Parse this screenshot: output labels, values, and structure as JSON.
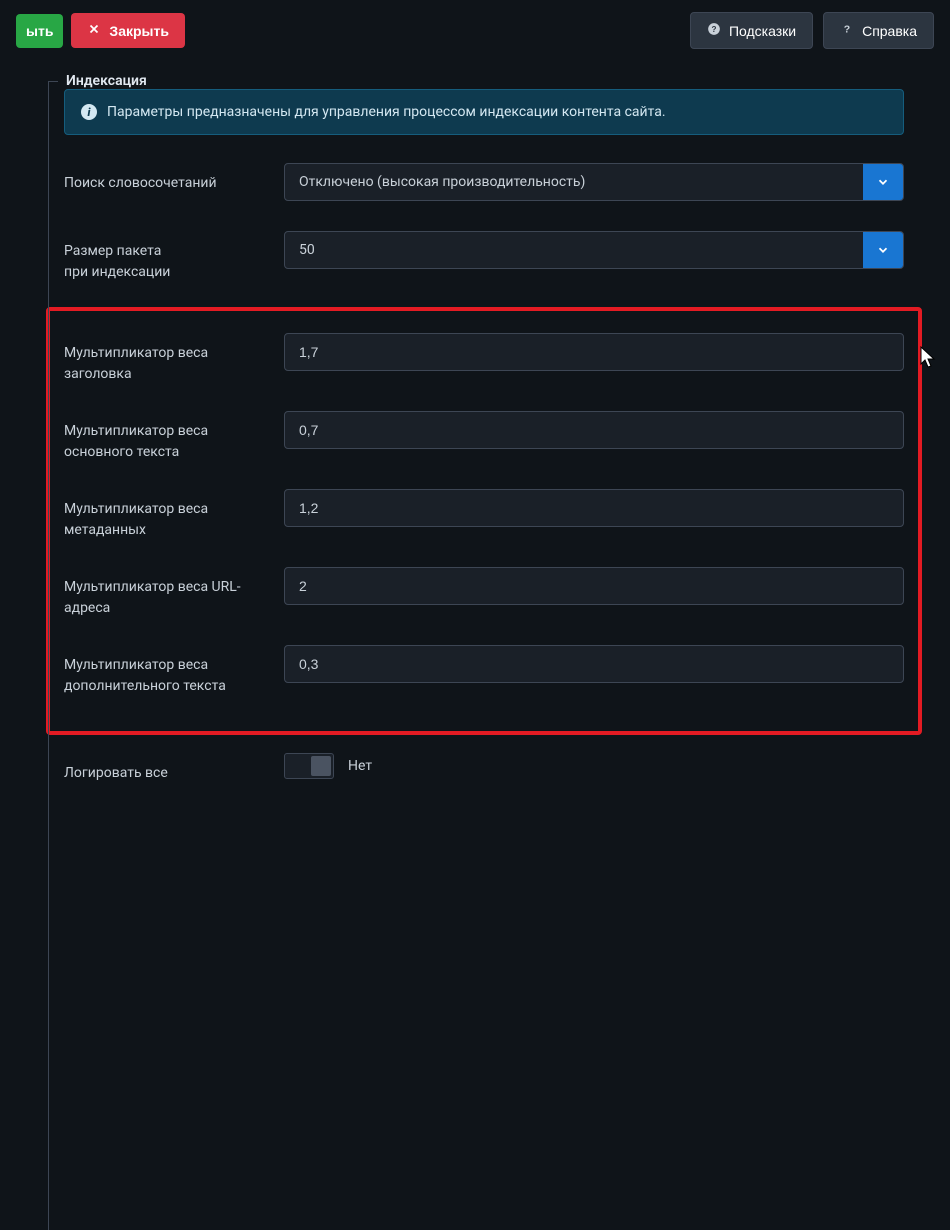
{
  "topbar": {
    "save_partial": "ыть",
    "close": "Закрыть",
    "hints": "Подсказки",
    "help": "Справка"
  },
  "fieldset": {
    "legend": "Индексация",
    "info": "Параметры предназначены для управления процессом индексации контента сайта."
  },
  "form": {
    "phrase_search": {
      "label": "Поиск словосочетаний",
      "value": "Отключено (высокая производительность)"
    },
    "batch_size": {
      "label_line1": "Размер пакета",
      "label_line2": "при индексации",
      "value": "50"
    },
    "mult_title": {
      "label": "Мультипликатор веса заголовка",
      "value": "1,7"
    },
    "mult_body": {
      "label": "Мультипликатор веса основного текста",
      "value": "0,7"
    },
    "mult_meta": {
      "label": "Мультипликатор веса метаданных",
      "value": "1,2"
    },
    "mult_url": {
      "label": "Мультипликатор веса URL-адреса",
      "value": "2"
    },
    "mult_extra": {
      "label": "Мультипликатор веса дополнительного текста",
      "value": "0,3"
    },
    "log_all": {
      "label": "Логировать все",
      "state": "Нет"
    }
  }
}
